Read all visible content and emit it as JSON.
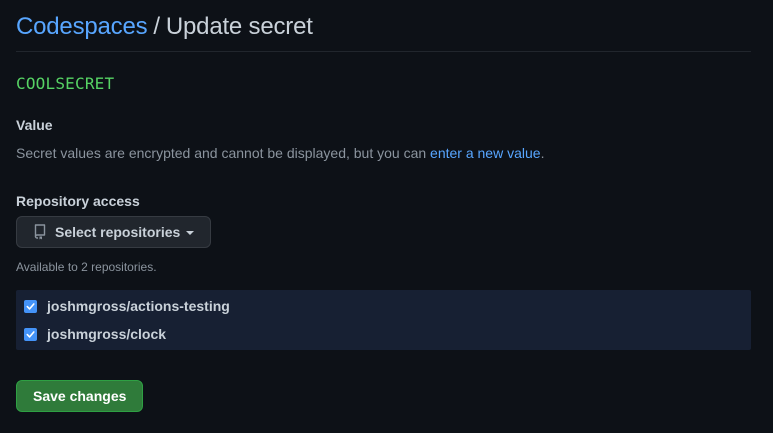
{
  "breadcrumb": {
    "parent": "Codespaces",
    "separator": "/",
    "current": "Update secret"
  },
  "secret": {
    "name": "COOLSECRET"
  },
  "value_section": {
    "label": "Value",
    "note": "Secret values are encrypted and cannot be displayed, but you can ",
    "link": "enter a new value",
    "note_end": "."
  },
  "repository_access": {
    "label": "Repository access",
    "select_button": "Select repositories",
    "select_icon": "repo-icon",
    "available_text": "Available to 2 repositories.",
    "repositories": [
      {
        "name": "joshmgross/actions-testing",
        "checked": true
      },
      {
        "name": "joshmgross/clock",
        "checked": true
      }
    ]
  },
  "actions": {
    "save": "Save changes"
  },
  "colors": {
    "background": "#0d1117",
    "link": "#58a6ff",
    "secret_name": "#56d364",
    "checkbox": "#4493f8",
    "save_button": "#2f7b3a"
  }
}
